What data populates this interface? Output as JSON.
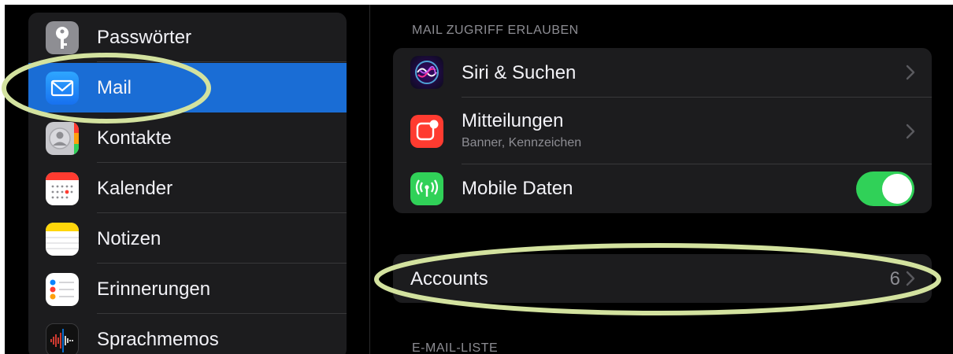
{
  "sidebar": {
    "items": [
      {
        "label": "Passwörter",
        "icon": "key-icon"
      },
      {
        "label": "Mail",
        "icon": "mail-icon",
        "selected": true
      },
      {
        "label": "Kontakte",
        "icon": "contacts-icon"
      },
      {
        "label": "Kalender",
        "icon": "calendar-icon"
      },
      {
        "label": "Notizen",
        "icon": "notes-icon"
      },
      {
        "label": "Erinnerungen",
        "icon": "reminders-icon"
      },
      {
        "label": "Sprachmemos",
        "icon": "voice-memos-icon"
      }
    ]
  },
  "detail": {
    "section_access": "MAIL ZUGRIFF ERLAUBEN",
    "siri": {
      "title": "Siri & Suchen"
    },
    "notifications": {
      "title": "Mitteilungen",
      "subtitle": "Banner, Kennzeichen"
    },
    "mobile_data": {
      "title": "Mobile Daten",
      "enabled": true
    },
    "accounts": {
      "title": "Accounts",
      "count": "6"
    },
    "section_list": "E-MAIL-LISTE"
  },
  "colors": {
    "accent": "#1a6dd5",
    "toggle_on": "#30d158",
    "highlight_ring": "#d3e29f",
    "background": "#000000",
    "cell": "#1c1c1e"
  }
}
